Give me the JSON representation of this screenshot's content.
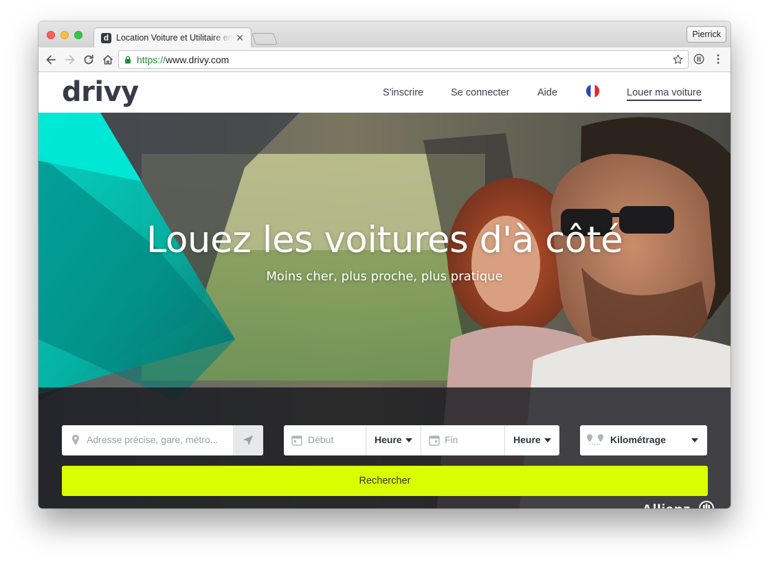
{
  "browser": {
    "tab_title": "Location Voiture et Utilitaire entre particuliers",
    "tab_favicon_letter": "d",
    "profile_name": "Pierrick",
    "url_scheme": "https://",
    "url_host": "www.drivy.com"
  },
  "site": {
    "logo": "drivy",
    "nav": {
      "signup": "S'inscrire",
      "login": "Se connecter",
      "help": "Aide",
      "rent_out": "Louer ma voiture"
    }
  },
  "hero": {
    "title": "Louez les voitures d'à côté",
    "subtitle": "Moins cher, plus proche, plus pratique"
  },
  "search": {
    "address_placeholder": "Adresse précise, gare, métro...",
    "start_placeholder": "Début",
    "start_hour": "Heure",
    "end_placeholder": "Fin",
    "end_hour": "Heure",
    "mileage": "Kilométrage",
    "submit": "Rechercher"
  },
  "partner": "Allianz",
  "colors": {
    "accent": "#d9ff00",
    "teal": "#00d6c5",
    "header_text": "#363b47"
  }
}
